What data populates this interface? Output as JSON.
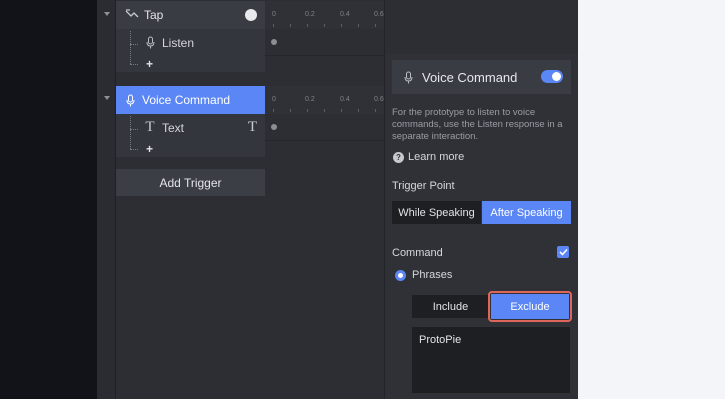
{
  "triggers": {
    "tap": {
      "label": "Tap",
      "responses": [
        {
          "label": "Listen"
        }
      ],
      "add_label": "+"
    },
    "voice_command": {
      "label": "Voice Command",
      "responses": [
        {
          "label": "Text"
        }
      ],
      "add_label": "+"
    },
    "add_trigger_label": "Add Trigger"
  },
  "timeline": {
    "ticks": [
      "0",
      "0.2",
      "0.4",
      "0.6"
    ]
  },
  "inspector": {
    "title": "Voice Command",
    "enabled": true,
    "description": "For the prototype to listen to voice commands, use the Listen response in a separate interaction.",
    "learn_more": "Learn more",
    "trigger_point": {
      "label": "Trigger Point",
      "options": [
        "While Speaking",
        "After Speaking"
      ],
      "selected": "After Speaking"
    },
    "command": {
      "label": "Command",
      "checked": true,
      "mode_label": "Phrases",
      "filter_options": [
        "Include",
        "Exclude"
      ],
      "selected_filter": "Exclude",
      "phrases_value": "ProtoPie"
    }
  },
  "colors": {
    "accent": "#5b86f5",
    "highlight": "#e0665c",
    "panel": "#2c2e34"
  }
}
